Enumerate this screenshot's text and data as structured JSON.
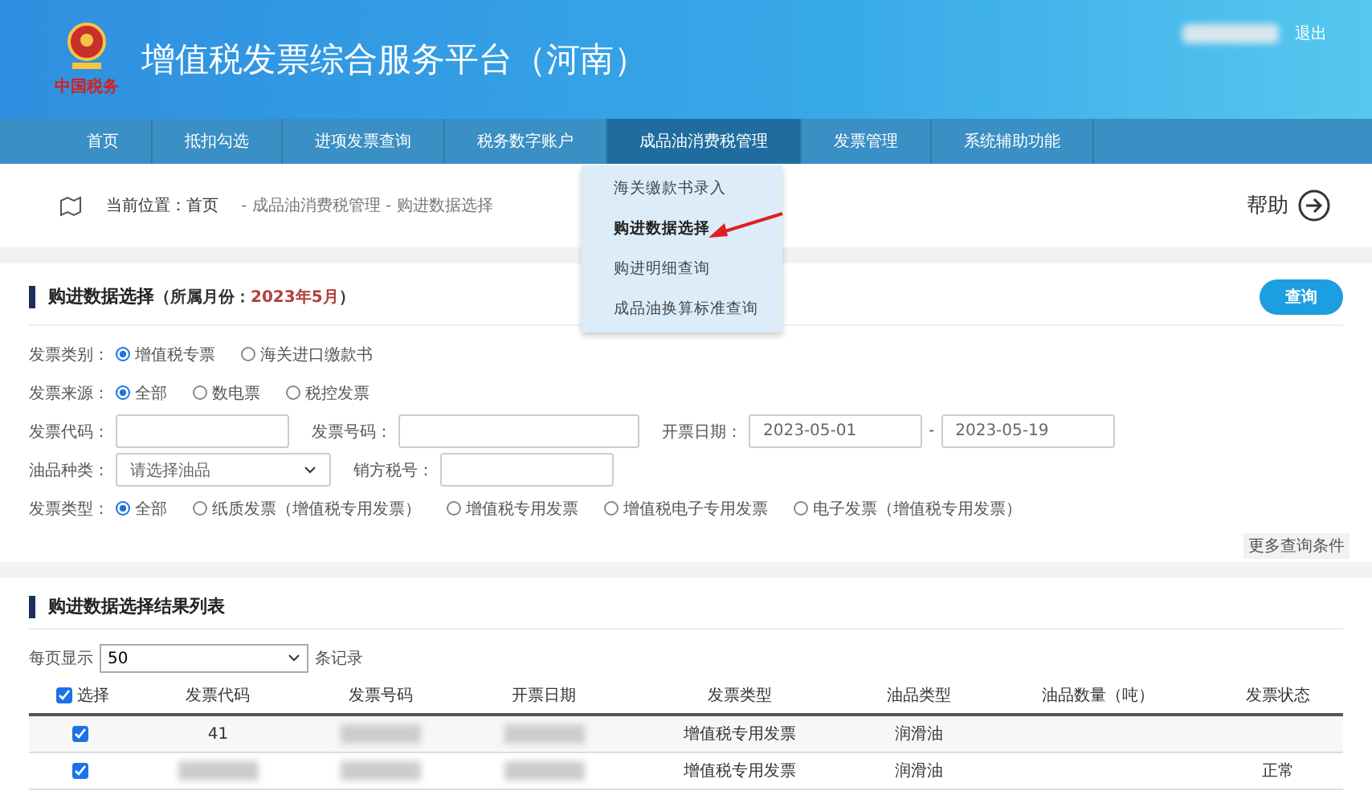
{
  "header": {
    "logo_text": "中国税务",
    "title": "增值税发票综合服务平台（河南）",
    "logout": "退出"
  },
  "nav": [
    {
      "label": "首页",
      "selected": false
    },
    {
      "label": "抵扣勾选",
      "selected": false
    },
    {
      "label": "进项发票查询",
      "selected": false
    },
    {
      "label": "税务数字账户",
      "selected": false
    },
    {
      "label": "成品油消费税管理",
      "selected": true
    },
    {
      "label": "发票管理",
      "selected": false
    },
    {
      "label": "系统辅助功能",
      "selected": false
    }
  ],
  "dropdown": {
    "items": [
      {
        "label": "海关缴款书录入",
        "selected": false
      },
      {
        "label": "购进数据选择",
        "selected": true
      },
      {
        "label": "购进明细查询",
        "selected": false
      },
      {
        "label": "成品油换算标准查询",
        "selected": false
      }
    ]
  },
  "breadcrumb": {
    "prefix": "当前位置：",
    "home": "首页",
    "path": "- 成品油消费税管理 - 购进数据选择",
    "help": "帮助"
  },
  "form": {
    "title": "购进数据选择",
    "month_label": "（所属月份：",
    "month": "2023年5月",
    "month_end": "）",
    "query_button": "查询",
    "radio_rows": [
      {
        "label": "发票类别：",
        "options": [
          {
            "label": "增值税专票",
            "selected": true
          },
          {
            "label": "海关进口缴款书",
            "selected": false
          }
        ]
      },
      {
        "label": "发票来源：",
        "options": [
          {
            "label": "全部",
            "selected": true
          },
          {
            "label": "数电票",
            "selected": false
          },
          {
            "label": "税控发票",
            "selected": false
          }
        ]
      }
    ],
    "code_label": "发票代码：",
    "number_label": "发票号码：",
    "date_label": "开票日期：",
    "date_from": "2023-05-01",
    "date_sep": "-",
    "date_to": "2023-05-19",
    "oil_label": "油品种类：",
    "oil_placeholder": "请选择油品",
    "seller_label": "销方税号：",
    "type_row": {
      "label": "发票类型：",
      "options": [
        {
          "label": "全部",
          "selected": true
        },
        {
          "label": "纸质发票（增值税专用发票）",
          "selected": false
        },
        {
          "label": "增值税专用发票",
          "selected": false
        },
        {
          "label": "增值税电子专用发票",
          "selected": false
        },
        {
          "label": "电子发票（增值税专用发票）",
          "selected": false
        }
      ]
    },
    "more": "更多查询条件"
  },
  "results": {
    "title": "购进数据选择结果列表",
    "per_page_label": "每页显示",
    "per_page": "50",
    "records_label": "条记录",
    "select_all": {
      "label": "选择",
      "checked": true
    },
    "columns": [
      "发票代码",
      "发票号码",
      "开票日期",
      "发票类型",
      "油品类型",
      "油品数量（吨）",
      "发票状态"
    ],
    "rows": [
      {
        "checked": true,
        "code": "41",
        "type": "增值税专用发票",
        "oil": "润滑油"
      },
      {
        "checked": true,
        "type": "增值税专用发票",
        "oil": "润滑油",
        "status": "正常"
      }
    ]
  }
}
